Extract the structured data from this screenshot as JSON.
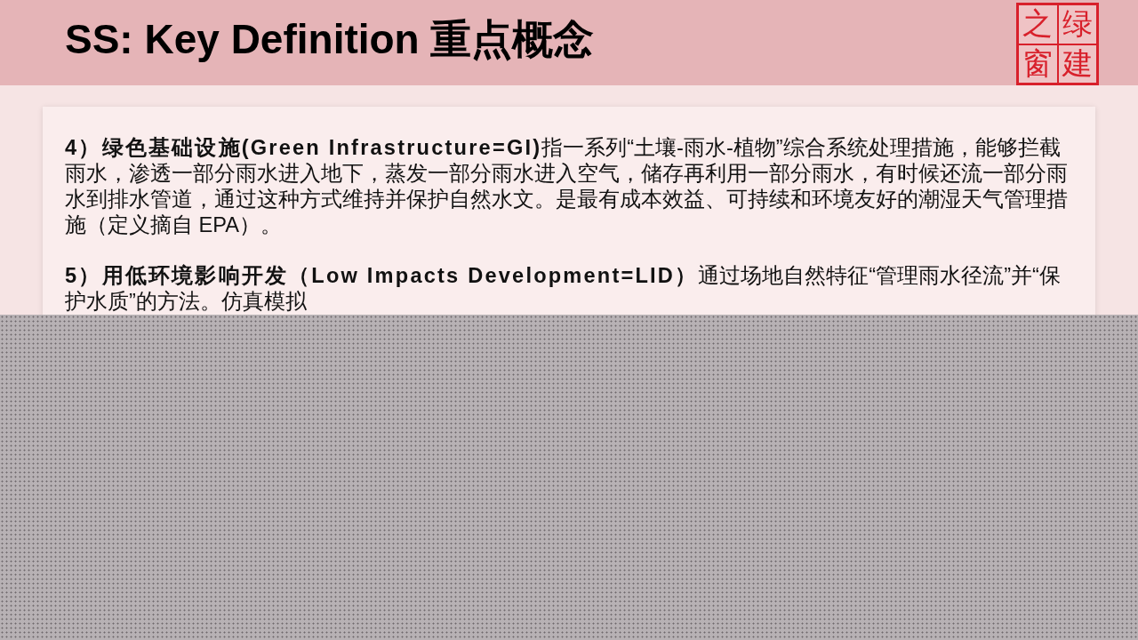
{
  "header": {
    "title": "SS: Key Definition 重点概念",
    "logo": {
      "cells": [
        "之",
        "绿",
        "窗",
        "建"
      ]
    }
  },
  "definitions": [
    {
      "text": "**4）绿色基础设施(Green Infrastructure=GI)**指一系列“土壤-雨水-植物”综合系统处理措施，能够拦截雨水，渗透一部分雨水进入地下，蒸发一部分雨水进入空气，储存再利用一部分雨水，有时候还流一部分雨水到排水管道，通过这种方式维持并保护自然水文。是最有成本效益、可持续和环境友好的潮湿天气管理措施（定义摘自 EPA）。"
    },
    {
      "text": "**5）用低环境影响开发（Low Impacts Development=LID）**通过场地自然特征“管理雨水径流”并“保护水质”的方法。仿真模拟"
    }
  ]
}
